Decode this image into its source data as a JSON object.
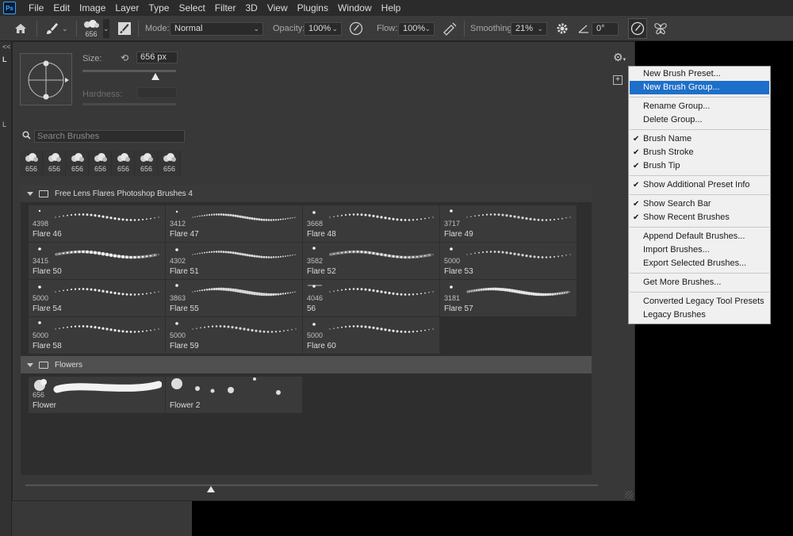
{
  "app": {
    "logo": "Ps"
  },
  "menubar": [
    "File",
    "Edit",
    "Image",
    "Layer",
    "Type",
    "Select",
    "Filter",
    "3D",
    "View",
    "Plugins",
    "Window",
    "Help"
  ],
  "options": {
    "brush_size": "656",
    "mode_label": "Mode:",
    "mode_value": "Normal",
    "opacity_label": "Opacity:",
    "opacity_value": "100%",
    "flow_label": "Flow:",
    "flow_value": "100%",
    "smoothing_label": "Smoothing:",
    "smoothing_value": "21%",
    "angle_value": "0°"
  },
  "left_strip": [
    "<<",
    "L",
    "L"
  ],
  "panel": {
    "size_label": "Size:",
    "size_value": "656 px",
    "size_level": 0.78,
    "hardness_label": "Hardness:",
    "search_placeholder": "Search Brushes",
    "recent_brushes": [
      "656",
      "656",
      "656",
      "656",
      "656",
      "656",
      "656"
    ],
    "groups": [
      {
        "name": "Free Lens Flares Photoshop Brushes 4",
        "brushes": [
          {
            "num": "4398",
            "name": "Flare 46"
          },
          {
            "num": "3412",
            "name": "Flare 47"
          },
          {
            "num": "3668",
            "name": "Flare 48"
          },
          {
            "num": "3717",
            "name": "Flare 49"
          },
          {
            "num": "3415",
            "name": "Flare 50"
          },
          {
            "num": "4302",
            "name": "Flare 51"
          },
          {
            "num": "3582",
            "name": "Flare 52"
          },
          {
            "num": "5000",
            "name": "Flare 53"
          },
          {
            "num": "5000",
            "name": "Flare 54"
          },
          {
            "num": "3863",
            "name": "Flare 55"
          },
          {
            "num": "4046",
            "name": "56"
          },
          {
            "num": "3181",
            "name": "Flare 57"
          },
          {
            "num": "5000",
            "name": "Flare 58"
          },
          {
            "num": "5000",
            "name": "Flare 59"
          },
          {
            "num": "5000",
            "name": "Flare 60"
          }
        ]
      },
      {
        "name": "Flowers",
        "brushes": [
          {
            "num": "656",
            "name": "Flower"
          },
          {
            "num": "",
            "name": "Flower 2"
          }
        ]
      }
    ]
  },
  "flyout": [
    {
      "type": "item",
      "label": "New Brush Preset..."
    },
    {
      "type": "item",
      "label": "New Brush Group...",
      "selected": true
    },
    {
      "type": "sep"
    },
    {
      "type": "item",
      "label": "Rename Group..."
    },
    {
      "type": "item",
      "label": "Delete Group..."
    },
    {
      "type": "sep"
    },
    {
      "type": "item",
      "label": "Brush Name",
      "checked": true
    },
    {
      "type": "item",
      "label": "Brush Stroke",
      "checked": true
    },
    {
      "type": "item",
      "label": "Brush Tip",
      "checked": true
    },
    {
      "type": "sep"
    },
    {
      "type": "item",
      "label": "Show Additional Preset Info",
      "checked": true
    },
    {
      "type": "sep"
    },
    {
      "type": "item",
      "label": "Show Search Bar",
      "checked": true
    },
    {
      "type": "item",
      "label": "Show Recent Brushes",
      "checked": true
    },
    {
      "type": "sep"
    },
    {
      "type": "item",
      "label": "Append Default Brushes..."
    },
    {
      "type": "item",
      "label": "Import Brushes..."
    },
    {
      "type": "item",
      "label": "Export Selected Brushes..."
    },
    {
      "type": "sep"
    },
    {
      "type": "item",
      "label": "Get More Brushes..."
    },
    {
      "type": "sep"
    },
    {
      "type": "item",
      "label": "Converted Legacy Tool Presets"
    },
    {
      "type": "item",
      "label": "Legacy Brushes"
    }
  ]
}
